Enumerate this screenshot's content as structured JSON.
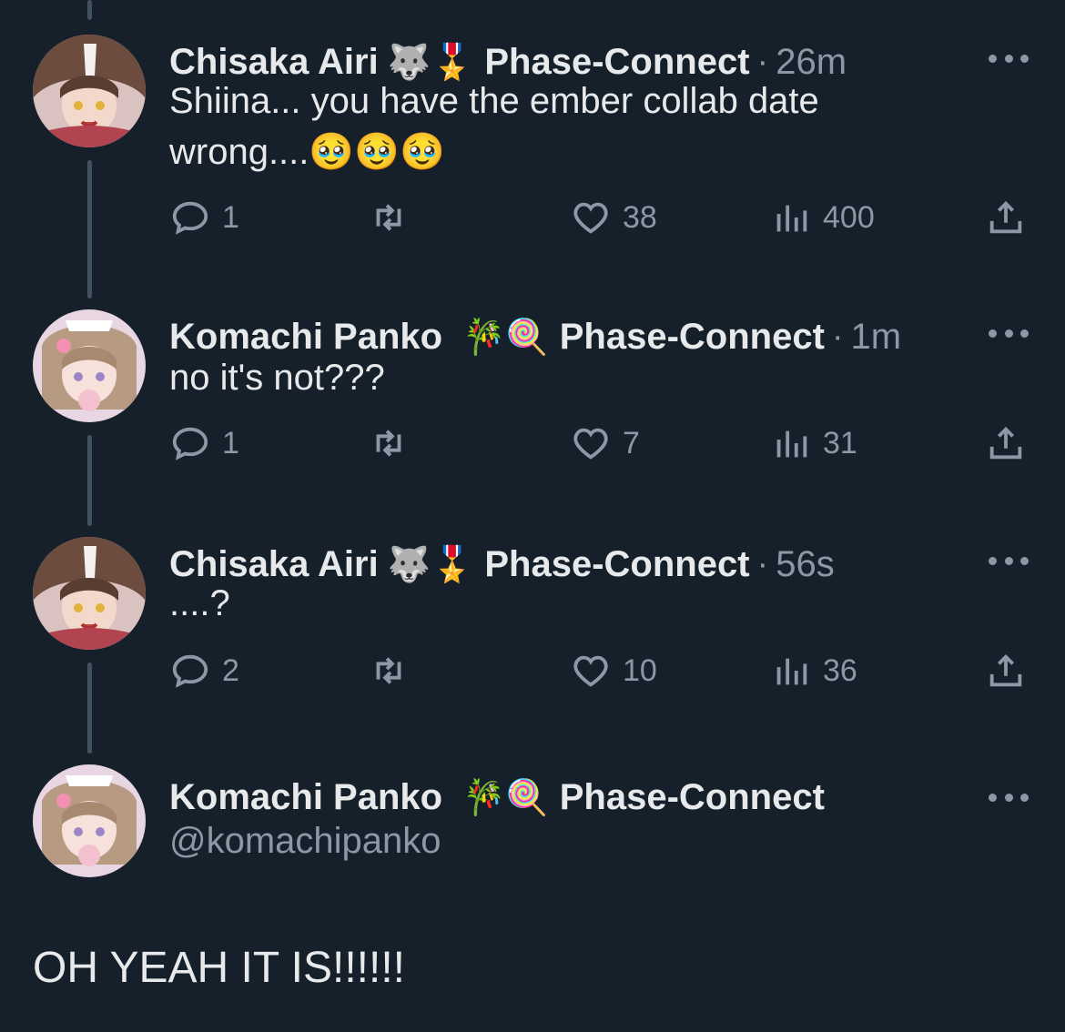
{
  "tweets": [
    {
      "name": "Chisaka Airi",
      "badges": "🐺🎖️",
      "affiliation": "Phase-Connect",
      "sep": "·",
      "time": "26m",
      "text_line1": "Shiina... you have the ember collab date",
      "text_line2": "wrong....🥹🥹🥹",
      "replies": "1",
      "likes": "38",
      "views": "400"
    },
    {
      "name": "Komachi Panko",
      "badges": "🎋🍭",
      "affiliation": "Phase-Connect",
      "sep": "·",
      "time": "1m",
      "text_line1": "no it's not???",
      "replies": "1",
      "likes": "7",
      "views": "31"
    },
    {
      "name": "Chisaka Airi",
      "badges": "🐺🎖️",
      "affiliation": "Phase-Connect",
      "sep": "·",
      "time": "56s",
      "text_line1": "....?",
      "replies": "2",
      "likes": "10",
      "views": "36"
    }
  ],
  "main_tweet": {
    "name": "Komachi Panko",
    "badges": "🎋🍭",
    "affiliation": "Phase-Connect",
    "handle": "@komachipanko",
    "text": "OH YEAH IT IS!!!!!!"
  },
  "icons": [
    "reply-icon",
    "retweet-icon",
    "like-icon",
    "views-icon",
    "share-icon",
    "more-icon"
  ],
  "colors": {
    "background": "#15202b",
    "text": "#e7e9ea",
    "muted": "#8b98a5",
    "thread_line": "#42535f"
  }
}
